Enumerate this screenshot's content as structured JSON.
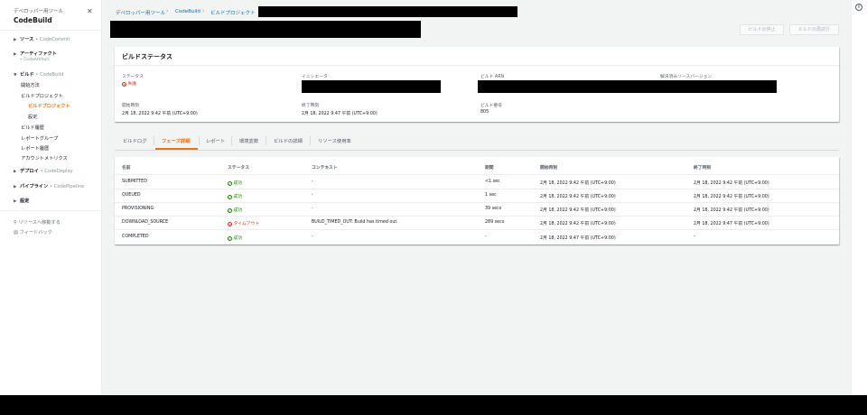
{
  "sidebar": {
    "top_label": "デベロッパー用ツール",
    "brand": "CodeBuild",
    "items": [
      {
        "label": "ソース",
        "sub": "• CodeCommit"
      },
      {
        "label": "アーティファクト",
        "sub2": "• CodeArtifact"
      },
      {
        "label": "ビルド",
        "sub": "• CodeBuild"
      },
      {
        "label": "開始方法"
      },
      {
        "label": "ビルドプロジェクト"
      },
      {
        "label": "ビルドプロジェクト"
      },
      {
        "label": "設定"
      },
      {
        "label": "ビルド履歴"
      },
      {
        "label": "レポートグループ"
      },
      {
        "label": "レポート履歴"
      },
      {
        "label": "アカウントメトリクス"
      },
      {
        "label": "デプロイ",
        "sub": "• CodeDeploy"
      },
      {
        "label": "パイプライン",
        "sub": "• CodePipeline"
      },
      {
        "label": "設定"
      }
    ],
    "util": [
      "リソースへ移動する",
      "フィードバック"
    ]
  },
  "breadcrumb": [
    "デベロッパー用ツール",
    "CodeBuild",
    "ビルドプロジェクト"
  ],
  "header": {
    "stop_label": "ビルドの停止",
    "retry_label": "ビルドの再試行"
  },
  "status_card": {
    "title": "ビルドステータス",
    "fields": {
      "status": {
        "label": "ステータス",
        "value": "失敗"
      },
      "initiator": {
        "label": "イニシエータ"
      },
      "arn": {
        "label": "ビルド ARN"
      },
      "resolved": {
        "label": "解決済みソースバージョン"
      },
      "start": {
        "label": "開始時刻",
        "value": "2月 18, 2022 9:42 午前 (UTC+9:00)"
      },
      "end": {
        "label": "終了時刻",
        "value": "2月 18, 2022 9:47 午前 (UTC+9:00)"
      },
      "number": {
        "label": "ビルド番号",
        "value": "805"
      }
    }
  },
  "tabs": [
    "ビルドログ",
    "フェーズ詳細",
    "レポート",
    "環境変数",
    "ビルドの詳細",
    "リソース使用率"
  ],
  "active_tab": 1,
  "table": {
    "headers": [
      "名前",
      "ステータス",
      "コンテキスト",
      "期間",
      "開始時刻",
      "終了時刻"
    ],
    "rows": [
      {
        "name": "SUBMITTED",
        "status": "成功",
        "status_type": "ok",
        "context": "-",
        "duration": "<1 sec",
        "start": "2月 18, 2022 9:42 午前 (UTC+9:00)",
        "end": "2月 18, 2022 9:42 午前 (UTC+9:00)"
      },
      {
        "name": "QUEUED",
        "status": "成功",
        "status_type": "ok",
        "context": "-",
        "duration": "1 sec",
        "start": "2月 18, 2022 9:42 午前 (UTC+9:00)",
        "end": "2月 18, 2022 9:42 午前 (UTC+9:00)"
      },
      {
        "name": "PROVISIONING",
        "status": "成功",
        "status_type": "ok",
        "context": "-",
        "duration": "39 secs",
        "start": "2月 18, 2022 9:42 午前 (UTC+9:00)",
        "end": "2月 18, 2022 9:42 午前 (UTC+9:00)"
      },
      {
        "name": "DOWNLOAD_SOURCE",
        "status": "タイムアウト",
        "status_type": "err",
        "context": "BUILD_TIMED_OUT: Build has timed out.",
        "duration": "289 secs",
        "start": "2月 18, 2022 9:42 午前 (UTC+9:00)",
        "end": "2月 18, 2022 9:47 午前 (UTC+9:00)"
      },
      {
        "name": "COMPLETED",
        "status": "成功",
        "status_type": "ok",
        "context": "-",
        "duration": "-",
        "start": "2月 18, 2022 9:47 午前 (UTC+9:00)",
        "end": "-"
      }
    ]
  },
  "colors": {
    "accent": "#ec7211",
    "link": "#0073bb",
    "success": "#1d8102",
    "error": "#d13212"
  }
}
